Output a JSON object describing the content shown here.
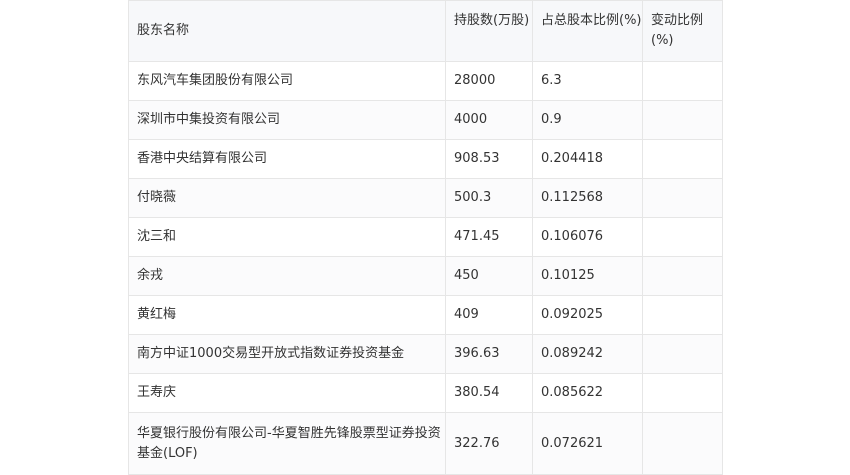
{
  "table": {
    "headers": {
      "name": "股东名称",
      "shares": "持股数(万股)",
      "pct": "占总股本比例(%)",
      "change": "变动比例(%)"
    },
    "rows": [
      {
        "name": "东风汽车集团股份有限公司",
        "shares": "28000",
        "pct": "6.3",
        "change": ""
      },
      {
        "name": "深圳市中集投资有限公司",
        "shares": "4000",
        "pct": "0.9",
        "change": ""
      },
      {
        "name": "香港中央结算有限公司",
        "shares": "908.53",
        "pct": "0.204418",
        "change": ""
      },
      {
        "name": "付晓薇",
        "shares": "500.3",
        "pct": "0.112568",
        "change": ""
      },
      {
        "name": "沈三和",
        "shares": "471.45",
        "pct": "0.106076",
        "change": ""
      },
      {
        "name": "余戎",
        "shares": "450",
        "pct": "0.10125",
        "change": ""
      },
      {
        "name": "黄红梅",
        "shares": "409",
        "pct": "0.092025",
        "change": ""
      },
      {
        "name": "南方中证1000交易型开放式指数证券投资基金",
        "shares": "396.63",
        "pct": "0.089242",
        "change": ""
      },
      {
        "name": "王寿庆",
        "shares": "380.54",
        "pct": "0.085622",
        "change": ""
      },
      {
        "name": "华夏银行股份有限公司-华夏智胜先锋股票型证券投资基金(LOF)",
        "shares": "322.76",
        "pct": "0.072621",
        "change": ""
      }
    ]
  }
}
